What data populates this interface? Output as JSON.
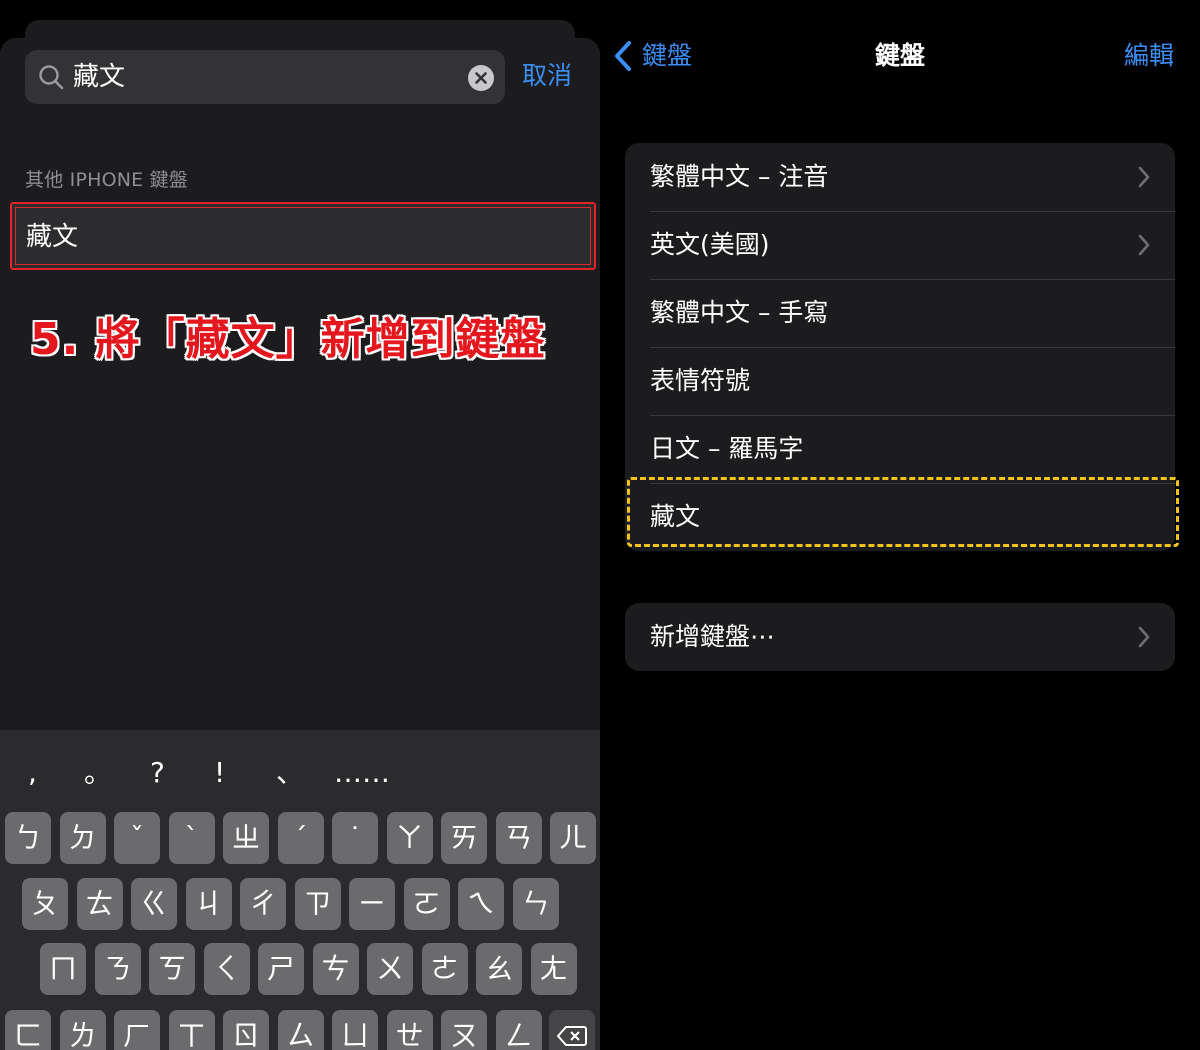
{
  "left": {
    "search": {
      "value": "藏文"
    },
    "cancel_label": "取消",
    "section_header": "其他 IPHONE 鍵盤",
    "result_label": "藏文",
    "annotation": "5. 將「藏文」新增到鍵盤",
    "annotation_color": "#e3171d",
    "keyboard": {
      "punct": [
        ",",
        "。",
        "?",
        "!",
        "、",
        "……"
      ],
      "row1": [
        "ㄅ",
        "ㄉ",
        "ˇ",
        "ˋ",
        "ㄓ",
        "ˊ",
        "˙",
        "ㄚ",
        "ㄞ",
        "ㄢ",
        "ㄦ"
      ],
      "row2": [
        "ㄆ",
        "ㄊ",
        "ㄍ",
        "ㄐ",
        "ㄔ",
        "ㄗ",
        "ㄧ",
        "ㄛ",
        "ㄟ",
        "ㄣ"
      ],
      "row3": [
        "ㄇ",
        "ㄋ",
        "ㄎ",
        "ㄑ",
        "ㄕ",
        "ㄘ",
        "ㄨ",
        "ㄜ",
        "ㄠ",
        "ㄤ"
      ],
      "row4": [
        "ㄈ",
        "ㄌ",
        "ㄏ",
        "ㄒ",
        "ㄖ",
        "ㄙ",
        "ㄩ",
        "ㄝ",
        "ㄡ",
        "ㄥ"
      ]
    }
  },
  "right": {
    "nav": {
      "back_label": "鍵盤",
      "title": "鍵盤",
      "edit_label": "編輯"
    },
    "keyboards": [
      "繁體中文 – 注音",
      "英文(美國)",
      "繁體中文 – 手寫",
      "表情符號",
      "日文 – 羅馬字",
      "藏文"
    ],
    "add_keyboard_label": "新增鍵盤⋯",
    "accent_color": "#3a8ef6",
    "highlight_color": "#f2c41a"
  }
}
